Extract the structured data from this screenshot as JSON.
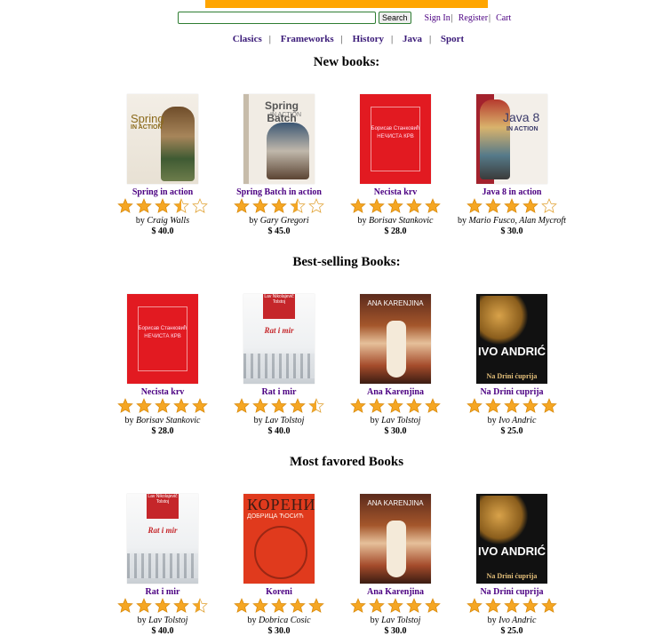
{
  "header": {
    "search_placeholder": "",
    "search_button": "Search",
    "sign_in": "Sign In",
    "register": "Register",
    "cart": "Cart",
    "separator": "|"
  },
  "nav": {
    "items": [
      "Clasics",
      "Frameworks",
      "History",
      "Java",
      "Sport"
    ],
    "separator": "|"
  },
  "colors": {
    "top_bar": "#ffa500",
    "link": "#4b0082",
    "star": "#f5a623"
  },
  "sections": [
    {
      "title": "New books:",
      "books": [
        {
          "title": "Spring in action",
          "author_prefix": "by",
          "author": "Craig Walls",
          "price": "$ 40.0",
          "rating": 3.5,
          "cover": "spring"
        },
        {
          "title": "Spring Batch in action",
          "author_prefix": "by",
          "author": "Gary Gregori",
          "price": "$ 45.0",
          "rating": 3.5,
          "cover": "batch"
        },
        {
          "title": "Necista krv",
          "author_prefix": "by",
          "author": "Borisav Stankovic",
          "price": "$ 28.0",
          "rating": 5,
          "cover": "red"
        },
        {
          "title": "Java 8 in action",
          "author_prefix": "by",
          "author": "Mario Fusco, Alan Mycroft",
          "price": "$ 30.0",
          "rating": 4,
          "cover": "java"
        }
      ]
    },
    {
      "title": "Best-selling Books:",
      "books": [
        {
          "title": "Necista krv",
          "author_prefix": "by",
          "author": "Borisav Stankovic",
          "price": "$ 28.0",
          "rating": 5,
          "cover": "red"
        },
        {
          "title": "Rat i mir",
          "author_prefix": "by",
          "author": "Lav Tolstoj",
          "price": "$ 40.0",
          "rating": 4.5,
          "cover": "war"
        },
        {
          "title": "Ana Karenjina",
          "author_prefix": "by",
          "author": "Lav Tolstoj",
          "price": "$ 30.0",
          "rating": 5,
          "cover": "ana"
        },
        {
          "title": "Na Drini cuprija",
          "author_prefix": "by",
          "author": "Ivo Andric",
          "price": "$ 25.0",
          "rating": 5,
          "cover": "ivo"
        }
      ]
    },
    {
      "title": "Most favored Books",
      "books": [
        {
          "title": "Rat i mir",
          "author_prefix": "by",
          "author": "Lav Tolstoj",
          "price": "$ 40.0",
          "rating": 4.5,
          "cover": "war"
        },
        {
          "title": "Koreni",
          "author_prefix": "by",
          "author": "Dobrica Cosic",
          "price": "$ 30.0",
          "rating": 5,
          "cover": "koreni"
        },
        {
          "title": "Ana Karenjina",
          "author_prefix": "by",
          "author": "Lav Tolstoj",
          "price": "$ 30.0",
          "rating": 5,
          "cover": "ana"
        },
        {
          "title": "Na Drini cuprija",
          "author_prefix": "by",
          "author": "Ivo Andric",
          "price": "$ 25.0",
          "rating": 5,
          "cover": "ivo"
        }
      ]
    }
  ],
  "covers": {
    "spring": {
      "line1": "Spring",
      "line2": "IN ACTION"
    },
    "batch": {
      "line1": "Spring Batch",
      "line2": "IN ACTION"
    },
    "red": {
      "line1": "Борисав Станковић",
      "line2": "НЕЧИСТА КРВ"
    },
    "java": {
      "line1": "Java 8",
      "line2": "IN ACTION"
    },
    "war": {
      "line1": "Lav Nikolajevič Tolstoj",
      "line2": "Rat i mir"
    },
    "ana": {
      "line1": "ANA KARENJINA"
    },
    "ivo": {
      "line1": "IVO ANDRIĆ",
      "line2": "Na Drini ćuprija"
    },
    "koreni": {
      "line1": "КОРЕНИ",
      "line2": "ДОБРИЦА ЋОСИЋ"
    }
  }
}
